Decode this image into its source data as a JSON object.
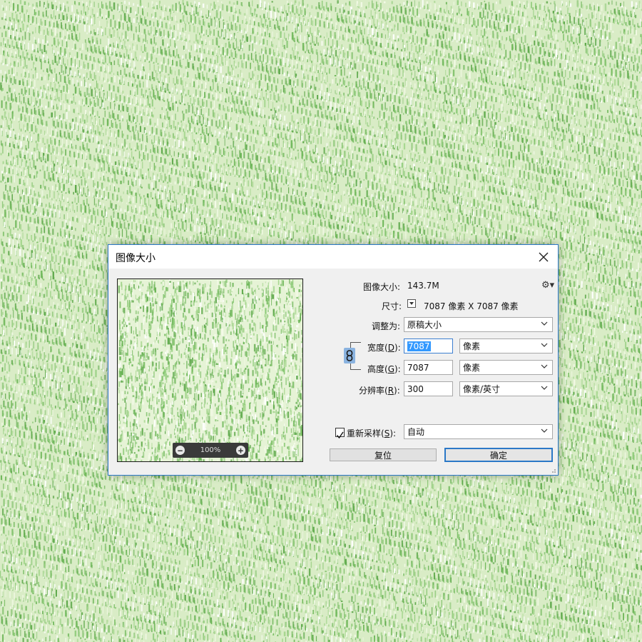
{
  "dialog": {
    "title": "图像大小"
  },
  "info": {
    "image_size_label": "图像大小:",
    "image_size_value": "143.7M",
    "dimensions_label": "尺寸:",
    "dimensions_value": "7087 像素  X  7087 像素"
  },
  "fit_to": {
    "label": "调整为:",
    "value": "原稿大小"
  },
  "width": {
    "label_pre": "宽度(",
    "label_key": "D",
    "label_post": "):",
    "value": "7087",
    "unit": "像素"
  },
  "height": {
    "label_pre": "高度(",
    "label_key": "G",
    "label_post": "):",
    "value": "7087",
    "unit": "像素"
  },
  "resolution": {
    "label_pre": "分辨率(",
    "label_key": "R",
    "label_post": "):",
    "value": "300",
    "unit": "像素/英寸"
  },
  "resample": {
    "label_pre": "重新采样(",
    "label_key": "S",
    "label_post": "):",
    "checked": true,
    "value": "自动"
  },
  "preview": {
    "zoom": "100%"
  },
  "buttons": {
    "reset": "复位",
    "ok": "确定"
  },
  "colors": {
    "accent": "#2b78c7",
    "background_texture": "#7fc06a",
    "selection": "#3399ff"
  }
}
